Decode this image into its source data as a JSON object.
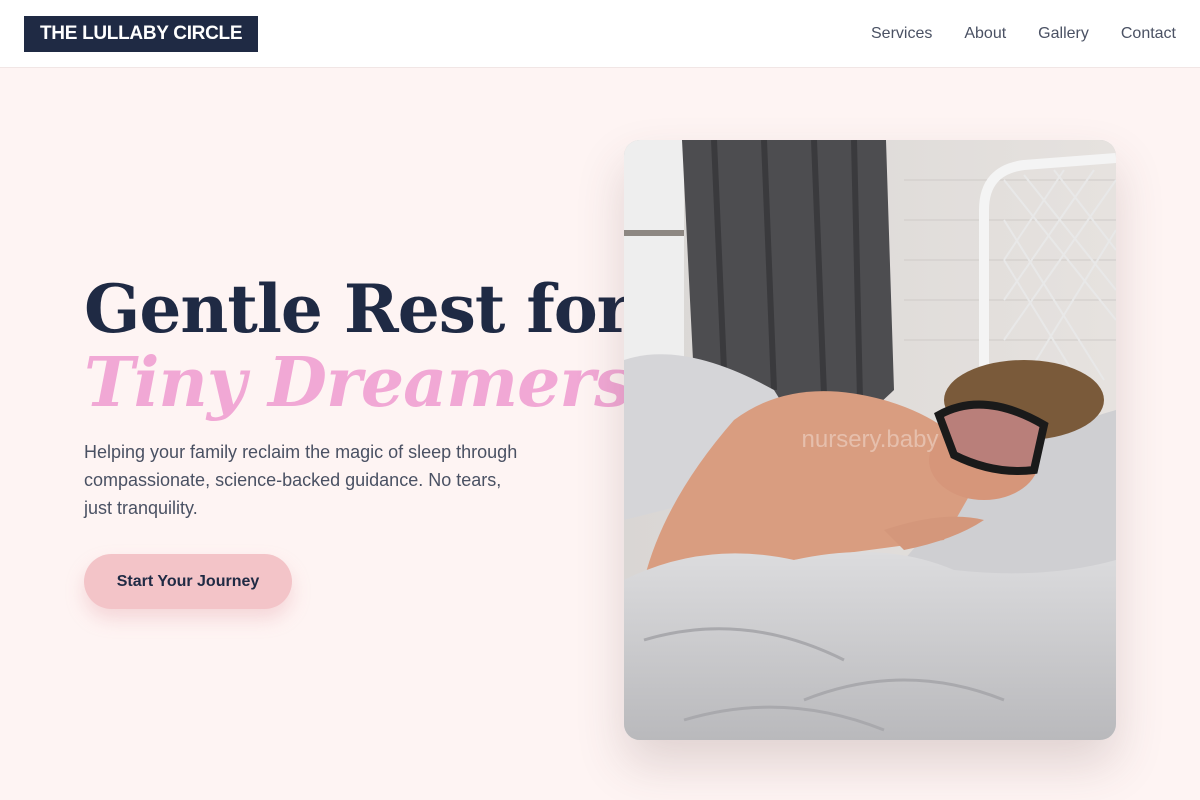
{
  "header": {
    "logo_text": "THE LULLABY CIRCLE",
    "nav": [
      "Services",
      "About",
      "Gallery",
      "Contact"
    ]
  },
  "hero": {
    "headline_line1": "Gentle Rest for",
    "headline_line2": "Tiny Dreamers.",
    "subtext": "Helping your family reclaim the magic of sleep through compassionate, science-backed guidance. No tears, just tranquility.",
    "cta_label": "Start Your Journey",
    "photo_watermark": "nursery.baby"
  },
  "colors": {
    "page_background": "#fef4f3",
    "navy": "#1f2a44",
    "pink_accent": "#f1a8d5",
    "cta_background": "#f3c4c8",
    "body_text": "#4a5163"
  }
}
